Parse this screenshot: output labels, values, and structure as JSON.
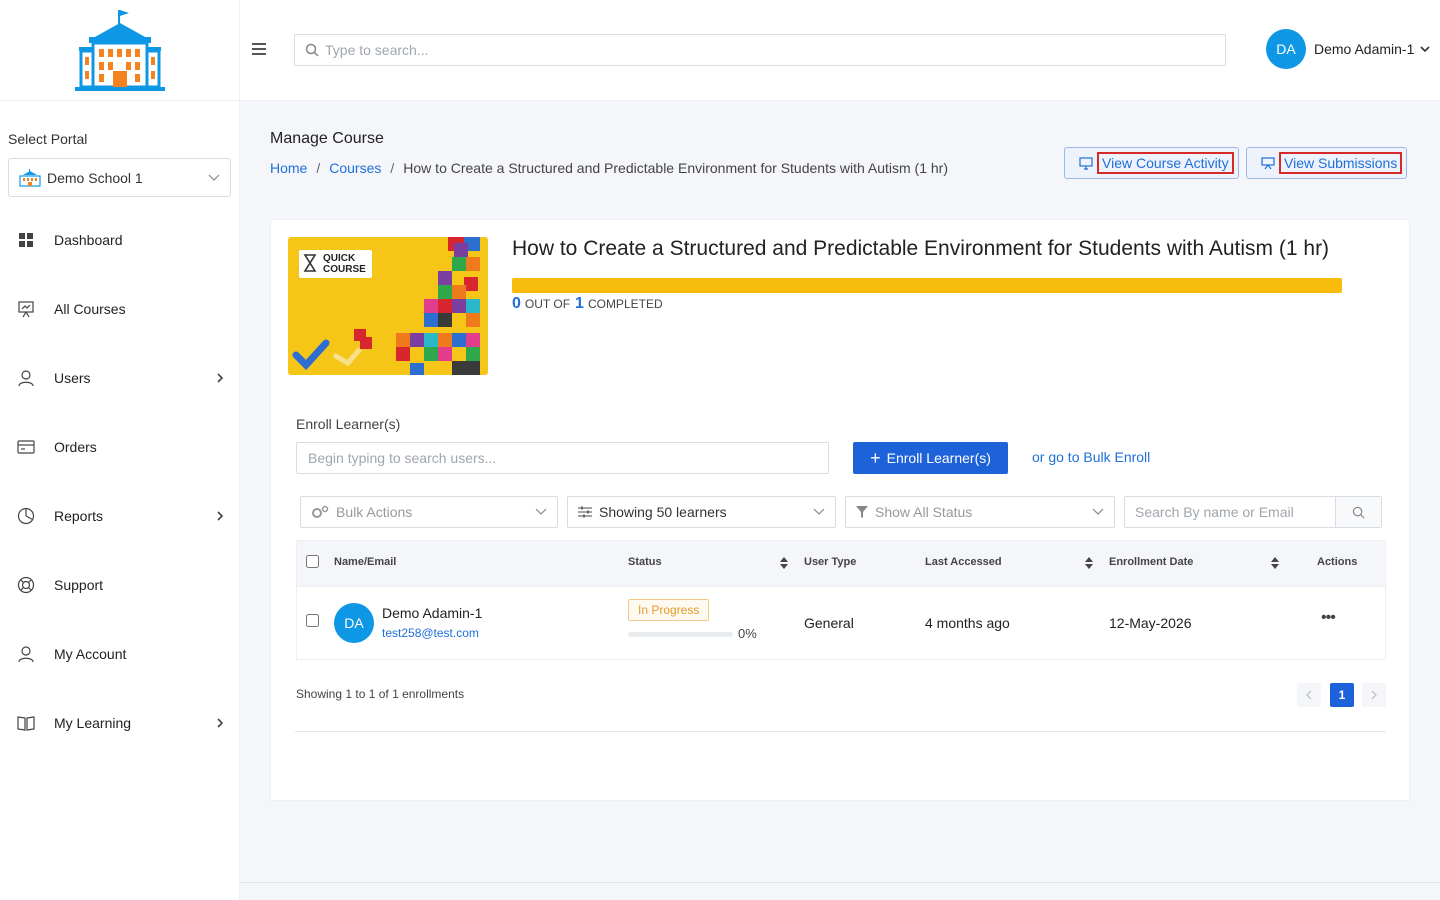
{
  "sidebar": {
    "portal_label": "Select Portal",
    "portal_value": "Demo School 1",
    "items": [
      {
        "label": "Dashboard"
      },
      {
        "label": "All Courses"
      },
      {
        "label": "Users"
      },
      {
        "label": "Orders"
      },
      {
        "label": "Reports"
      },
      {
        "label": "Support"
      },
      {
        "label": "My Account"
      },
      {
        "label": "My Learning"
      }
    ]
  },
  "topbar": {
    "search_placeholder": "Type to search...",
    "user_initials": "DA",
    "user_name": "Demo Adamin-1"
  },
  "page": {
    "title": "Manage Course",
    "breadcrumb": {
      "home": "Home",
      "courses": "Courses",
      "current": "How to Create a Structured and Predictable Environment for Students with Autism (1 hr)"
    },
    "btn_activity": "View Course Activity",
    "btn_submissions": "View Submissions"
  },
  "course": {
    "badge_line1": "QUICK",
    "badge_line2": "COURSE",
    "title": "How to Create a Structured and Predictable Environment for Students with Autism (1 hr)",
    "progress_fraction": 1,
    "completed_count": "0",
    "out_of_label": "OUT OF",
    "total_count": "1",
    "completed_label": "COMPLETED"
  },
  "enroll": {
    "label": "Enroll Learner(s)",
    "placeholder": "Begin typing to search users...",
    "button": "Enroll Learner(s)",
    "bulk_link": "or go to Bulk Enroll"
  },
  "filters": {
    "bulk_actions": "Bulk Actions",
    "showing": "Showing 50 learners",
    "status": "Show All Status",
    "search_placeholder": "Search By name or Email"
  },
  "table": {
    "headers": {
      "name": "Name/Email",
      "status": "Status",
      "user_type": "User Type",
      "last_accessed": "Last Accessed",
      "enrollment_date": "Enrollment Date",
      "actions": "Actions"
    },
    "rows": [
      {
        "initials": "DA",
        "name": "Demo Adamin-1",
        "email": "test258@test.com",
        "status": "In Progress",
        "progress_fraction": 0,
        "progress_text": "0%",
        "user_type": "General",
        "last_accessed": "4 months ago",
        "enrollment_date": "12-May-2026"
      }
    ]
  },
  "pagination": {
    "summary": "Showing 1 to 1 of 1 enrollments",
    "current_page": "1"
  },
  "colors": {
    "primary": "#1e62d9",
    "link": "#1e6fd9",
    "avatar": "#0d97e5",
    "progress": "#f7bc0c",
    "highlight_box": "#d42a2a"
  }
}
